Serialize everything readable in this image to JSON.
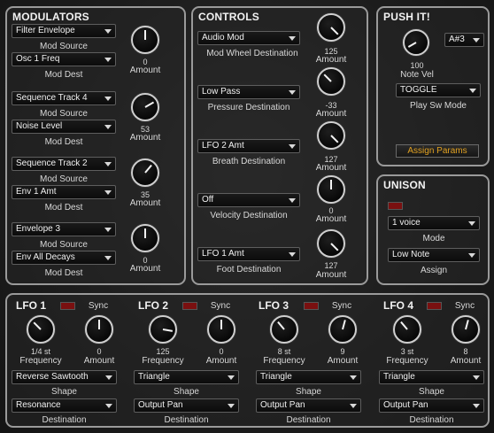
{
  "modulators": {
    "title": "MODULATORS",
    "slots": [
      {
        "source": "Filter Envelope",
        "source_label": "Mod Source",
        "dest": "Osc 1 Freq",
        "dest_label": "Mod Dest",
        "amount": "0",
        "amount_label": "Amount"
      },
      {
        "source": "Sequence Track 4",
        "source_label": "Mod Source",
        "dest": "Noise Level",
        "dest_label": "Mod Dest",
        "amount": "53",
        "amount_label": "Amount"
      },
      {
        "source": "Sequence Track 2",
        "source_label": "Mod Source",
        "dest": "Env 1 Amt",
        "dest_label": "Mod Dest",
        "amount": "35",
        "amount_label": "Amount"
      },
      {
        "source": "Envelope 3",
        "source_label": "Mod Source",
        "dest": "Env All Decays",
        "dest_label": "Mod Dest",
        "amount": "0",
        "amount_label": "Amount"
      }
    ]
  },
  "controls": {
    "title": "CONTROLS",
    "rows": [
      {
        "value": "Audio Mod",
        "label": "Mod Wheel Destination",
        "amount": "125",
        "amount_label": "Amount"
      },
      {
        "value": "Low Pass",
        "label": "Pressure Destination",
        "amount": "-33",
        "amount_label": "Amount"
      },
      {
        "value": "LFO 2 Amt",
        "label": "Breath Destination",
        "amount": "127",
        "amount_label": "Amount"
      },
      {
        "value": "Off",
        "label": "Velocity Destination",
        "amount": "0",
        "amount_label": "Amount"
      },
      {
        "value": "LFO 1 Amt",
        "label": "Foot Destination",
        "amount": "127",
        "amount_label": "Amount"
      }
    ]
  },
  "push_it": {
    "title": "PUSH IT!",
    "note": "A#3",
    "vel_value": "100",
    "vel_label": "Note Vel",
    "mode": "TOGGLE",
    "mode_label": "Play Sw Mode",
    "assign_button": "Assign Params"
  },
  "unison": {
    "title": "UNISON",
    "mode": "1 voice",
    "mode_label": "Mode",
    "assign": "Low Note",
    "assign_label": "Assign"
  },
  "lfos": [
    {
      "title": "LFO 1",
      "sync_label": "Sync",
      "freq": "1/4 st",
      "freq_label": "Frequency",
      "amount": "0",
      "amount_label": "Amount",
      "shape": "Reverse Sawtooth",
      "shape_label": "Shape",
      "dest": "Resonance",
      "dest_label": "Destination"
    },
    {
      "title": "LFO 2",
      "sync_label": "Sync",
      "freq": "125",
      "freq_label": "Frequency",
      "amount": "0",
      "amount_label": "Amount",
      "shape": "Triangle",
      "shape_label": "Shape",
      "dest": "Output Pan",
      "dest_label": "Destination"
    },
    {
      "title": "LFO 3",
      "sync_label": "Sync",
      "freq": "8 st",
      "freq_label": "Frequency",
      "amount": "9",
      "amount_label": "Amount",
      "shape": "Triangle",
      "shape_label": "Shape",
      "dest": "Output Pan",
      "dest_label": "Destination"
    },
    {
      "title": "LFO 4",
      "sync_label": "Sync",
      "freq": "3 st",
      "freq_label": "Frequency",
      "amount": "8",
      "amount_label": "Amount",
      "shape": "Triangle",
      "shape_label": "Shape",
      "dest": "Output Pan",
      "dest_label": "Destination"
    }
  ],
  "colors": {
    "led": "#7a1010",
    "assign_text": "#e0a020",
    "panel_border": "#9a9a9a"
  }
}
